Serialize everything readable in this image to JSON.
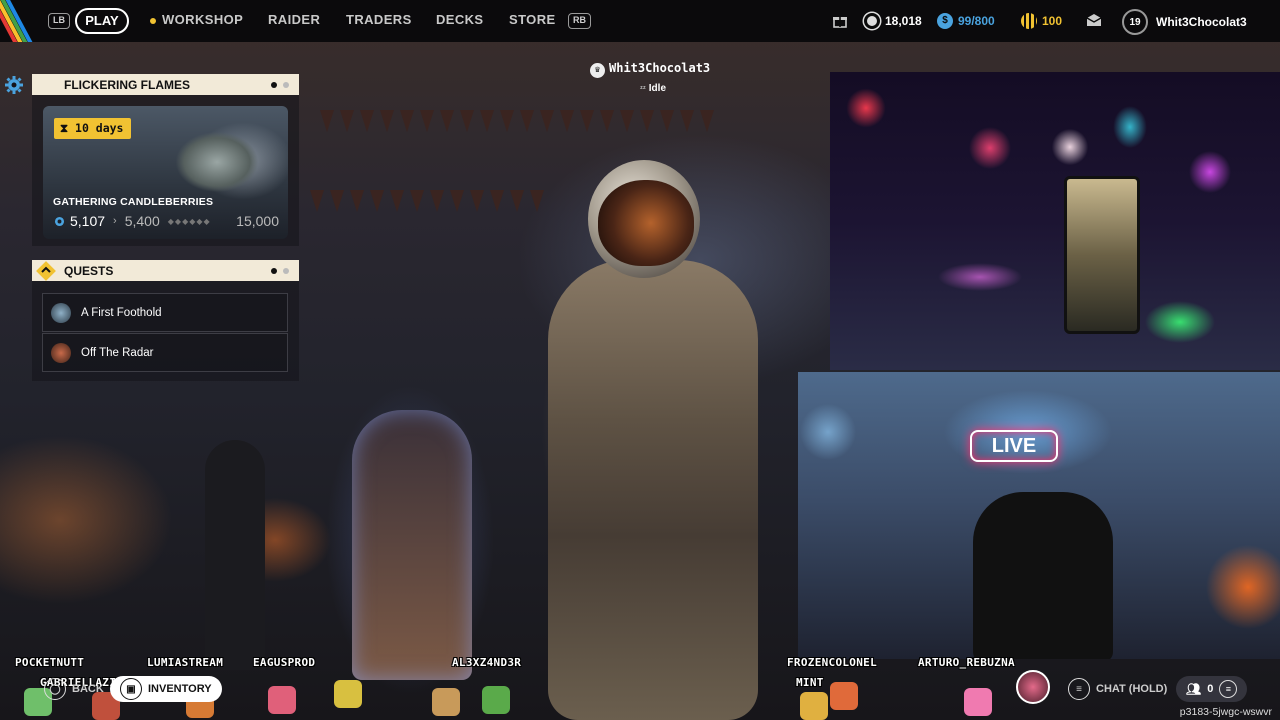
{
  "topbar": {
    "left_bumper": "LB",
    "right_bumper": "RB",
    "nav": [
      "PLAY",
      "WORKSHOP",
      "RAIDER",
      "TRADERS",
      "DECKS",
      "STORE"
    ],
    "currency_coins": "18,018",
    "currency_cred": "99/800",
    "currency_tickets": "100",
    "player_level": "19",
    "player_name": "Whit3Chocolat3"
  },
  "event_panel": {
    "title": "FLICKERING FLAMES",
    "time_left": "10 days",
    "task": "GATHERING CANDLEBERRIES",
    "progress_current": "5,107",
    "progress_next": "5,400",
    "progress_max": "15,000"
  },
  "quests_panel": {
    "title": "QUESTS",
    "items": [
      {
        "label": "A First Foothold"
      },
      {
        "label": "Off The Radar"
      }
    ]
  },
  "player_tag": {
    "name": "Whit3Chocolat3",
    "status": "Idle"
  },
  "webcam": {
    "sign_text": "LIVE"
  },
  "chat_overlay": {
    "names": [
      "POCKETNUTT",
      "LUMIASTREAM",
      "EAGUSPROD",
      "AL3XZ4ND3R",
      "FROZENCOLONEL",
      "ARTURO_REBUZNA",
      "GABRIELLAZINHA",
      "MINT"
    ]
  },
  "bottom_bar": {
    "back_label": "BACK",
    "inventory_label": "INVENTORY",
    "chat_label": "CHAT (HOLD)",
    "party_count": "0",
    "session_id": "p3183-5jwgc-wswvr"
  },
  "colors": {
    "accent_yellow": "#f1c232",
    "cred_blue": "#4aa3df",
    "panel_header": "#f2ead8"
  }
}
